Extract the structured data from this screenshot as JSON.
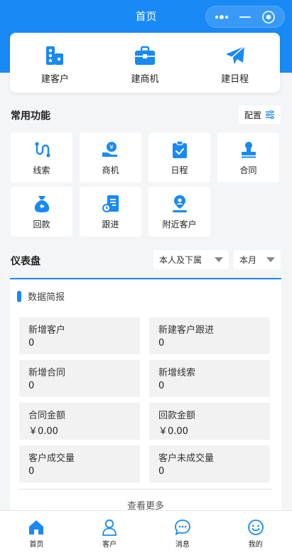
{
  "header": {
    "title": "首页"
  },
  "quick_actions": [
    {
      "label": "建客户",
      "icon": "building-icon"
    },
    {
      "label": "建商机",
      "icon": "briefcase-icon"
    },
    {
      "label": "建日程",
      "icon": "paper-plane-icon"
    }
  ],
  "common": {
    "title": "常用功能",
    "config_label": "配置",
    "items": [
      {
        "label": "线索",
        "icon": "clue-icon"
      },
      {
        "label": "商机",
        "icon": "opportunity-icon"
      },
      {
        "label": "日程",
        "icon": "calendar-icon"
      },
      {
        "label": "合同",
        "icon": "stamp-icon"
      },
      {
        "label": "回款",
        "icon": "money-bag-icon"
      },
      {
        "label": "跟进",
        "icon": "follow-up-icon"
      },
      {
        "label": "附近客户",
        "icon": "location-icon"
      }
    ]
  },
  "dashboard": {
    "title": "仪表盘",
    "scope_select": "本人及下属",
    "period_select": "本月",
    "card_title": "数据简报",
    "stats": [
      {
        "label": "新增客户",
        "value": "0"
      },
      {
        "label": "新建客户跟进",
        "value": "0"
      },
      {
        "label": "新增合同",
        "value": "0"
      },
      {
        "label": "新增线索",
        "value": "0"
      },
      {
        "label": "合同金额",
        "value": "￥0.00"
      },
      {
        "label": "回款金额",
        "value": "￥0.00"
      },
      {
        "label": "客户成交量",
        "value": "0"
      },
      {
        "label": "客户未成交量",
        "value": "0"
      }
    ],
    "more_label": "查看更多"
  },
  "tabbar": [
    {
      "label": "首页",
      "icon": "home-icon",
      "active": true
    },
    {
      "label": "客户",
      "icon": "user-icon",
      "active": false
    },
    {
      "label": "消息",
      "icon": "message-icon",
      "active": false
    },
    {
      "label": "我的",
      "icon": "smile-icon",
      "active": false
    }
  ],
  "colors": {
    "accent": "#1889f5",
    "background": "#f4f5f7"
  }
}
